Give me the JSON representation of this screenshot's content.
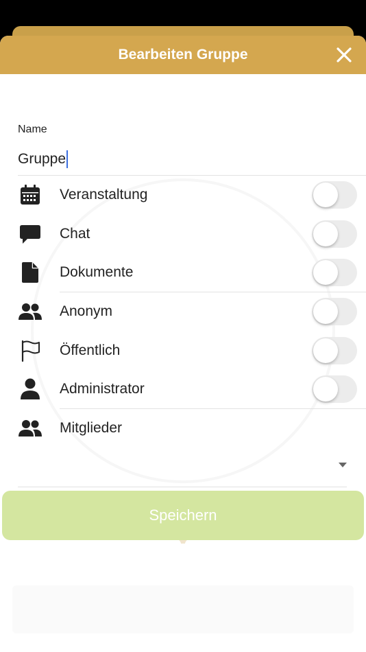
{
  "header": {
    "title": "Bearbeiten Gruppe"
  },
  "form": {
    "name_label": "Name",
    "name_value": "Gruppe"
  },
  "options": [
    {
      "id": "veranstaltung",
      "label": "Veranstaltung",
      "icon": "calendar-icon",
      "enabled": false
    },
    {
      "id": "chat",
      "label": "Chat",
      "icon": "chat-bubble-icon",
      "enabled": false
    },
    {
      "id": "dokumente",
      "label": "Dokumente",
      "icon": "document-icon",
      "enabled": false
    },
    {
      "id": "anonym",
      "label": "Anonym",
      "icon": "users-icon",
      "enabled": false
    },
    {
      "id": "oeffentlich",
      "label": "Öffentlich",
      "icon": "flag-icon",
      "enabled": false
    },
    {
      "id": "administrator",
      "label": "Administrator",
      "icon": "user-icon",
      "enabled": false
    }
  ],
  "members": {
    "label": "Mitglieder",
    "icon": "users-icon"
  },
  "save": {
    "label": "Speichern"
  },
  "colors": {
    "header": "#d4a74f",
    "save_button": "#d4e6a0",
    "caret": "#3b6fe0"
  }
}
